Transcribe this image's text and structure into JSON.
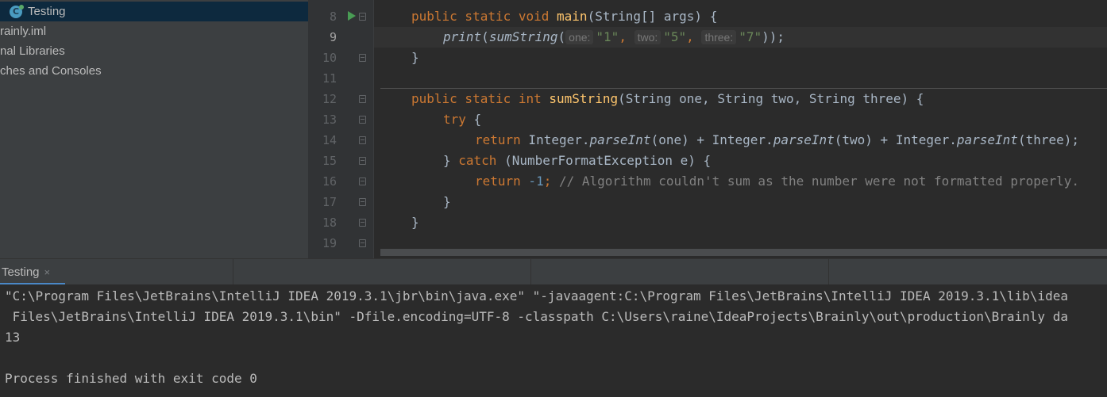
{
  "project_tree": {
    "items": [
      {
        "label": "Testing",
        "selected": true,
        "icon": "java-class-icon"
      },
      {
        "label": "rainly.iml"
      },
      {
        "label": "nal Libraries"
      },
      {
        "label": "ches and Consoles"
      }
    ]
  },
  "editor": {
    "line_numbers": [
      "8",
      "9",
      "10",
      "11",
      "12",
      "13",
      "14",
      "15",
      "16",
      "17",
      "18",
      "19"
    ],
    "current_line": "9",
    "lines": {
      "l8": {
        "kw1": "public static void ",
        "fn": "main",
        "rest": "(String[] args) {"
      },
      "l9": {
        "fn_print": "print",
        "p1": "(",
        "fn_sum": "sumString",
        "p2": "(",
        "hint_one": "one:",
        "arg_one": "\"1\"",
        "c1": ", ",
        "hint_two": "two:",
        "arg_two": "\"5\"",
        "c2": ", ",
        "hint_three": "three:",
        "arg_three": "\"7\"",
        "end": "));"
      },
      "l10": {
        "text": "}"
      },
      "l12": {
        "kw1": "public static int ",
        "fn": "sumString",
        "rest": "(String one, String two, String three) {"
      },
      "l13": {
        "kw": "try",
        "rest": " {"
      },
      "l14": {
        "kw": "return",
        "t1": " Integer.",
        "m1": "parseInt",
        "t2": "(one) + Integer.",
        "m2": "parseInt",
        "t3": "(two) + Integer.",
        "m3": "parseInt",
        "t4": "(three);"
      },
      "l15": {
        "b": "} ",
        "kw": "catch",
        "rest": " (NumberFormatException e) {"
      },
      "l16": {
        "kw": "return",
        "num": " -1",
        "semi": ";",
        "cmt": " // Algorithm couldn't sum as the number were not formatted properly."
      },
      "l17": {
        "text": "}"
      },
      "l18": {
        "text": "}"
      }
    }
  },
  "run_panel": {
    "tab_label": "Testing",
    "tab_close": "×",
    "console_lines": [
      "\"C:\\Program Files\\JetBrains\\IntelliJ IDEA 2019.3.1\\jbr\\bin\\java.exe\" \"-javaagent:C:\\Program Files\\JetBrains\\IntelliJ IDEA 2019.3.1\\lib\\idea",
      " Files\\JetBrains\\IntelliJ IDEA 2019.3.1\\bin\" -Dfile.encoding=UTF-8 -classpath C:\\Users\\raine\\IdeaProjects\\Brainly\\out\\production\\Brainly da",
      "13",
      "",
      "Process finished with exit code 0"
    ]
  },
  "colors": {
    "keyword": "#cc7832",
    "function": "#ffc66d",
    "string": "#6a8759",
    "number": "#6897bb",
    "comment": "#808080",
    "run_accent": "#4a88c7"
  }
}
